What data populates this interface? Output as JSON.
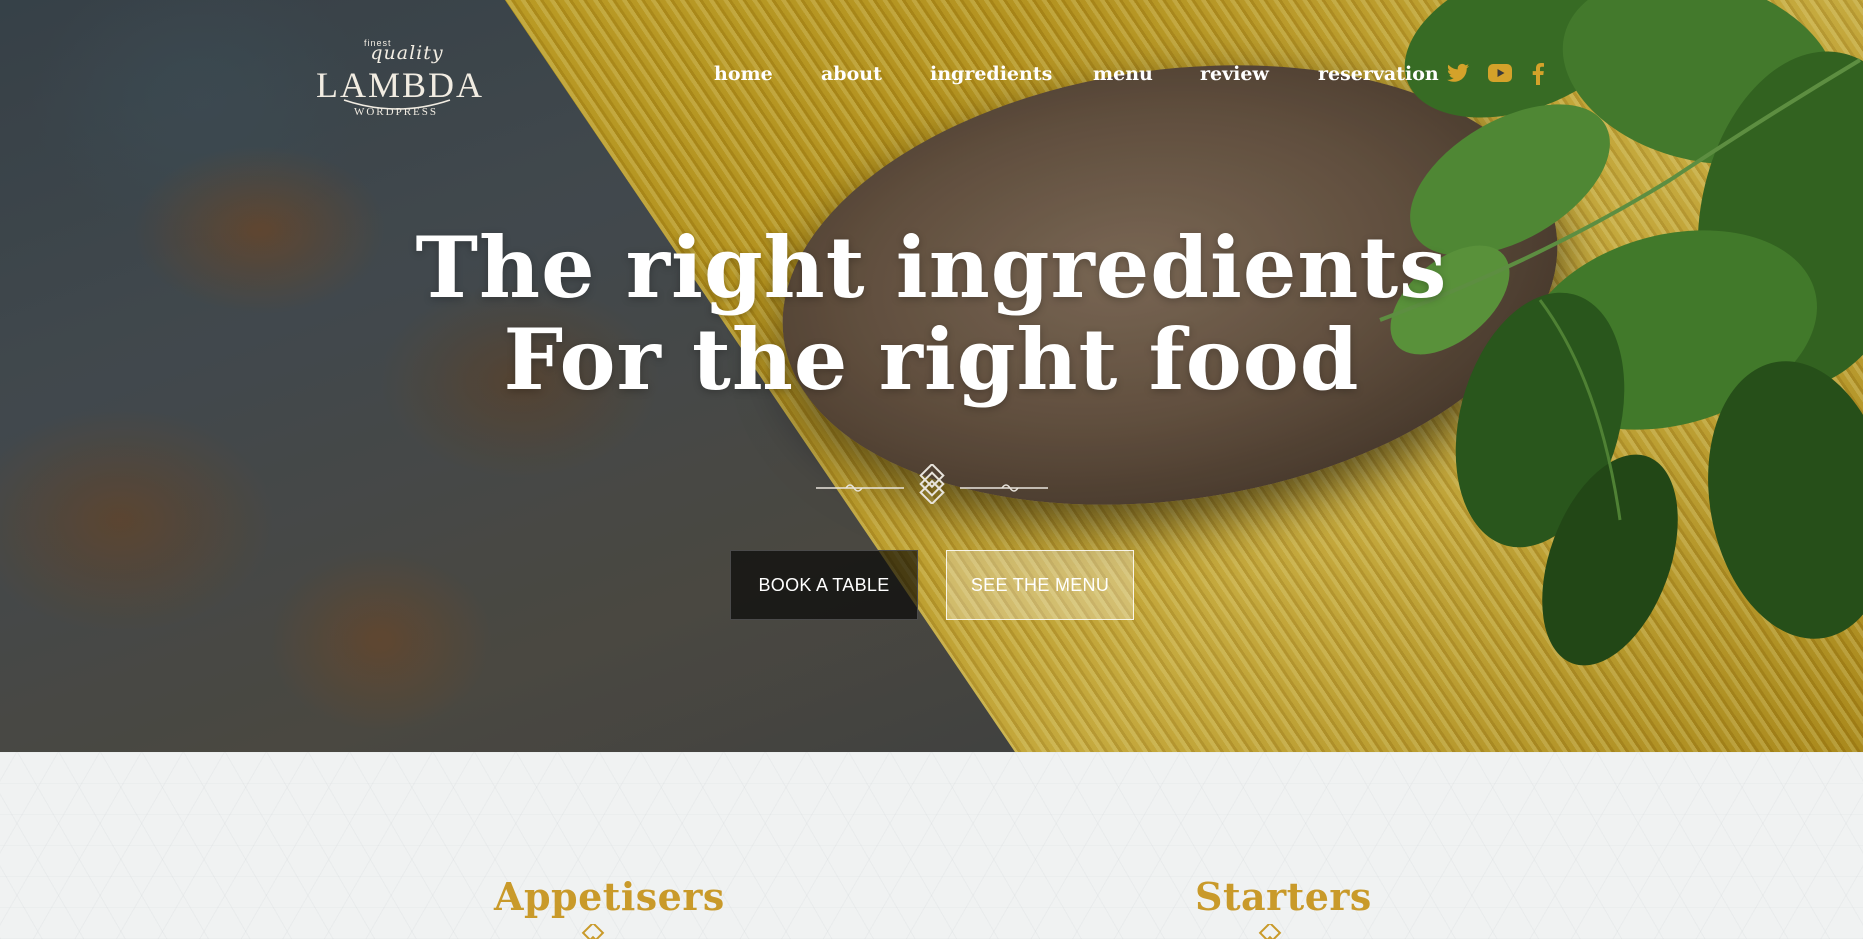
{
  "logo": {
    "finest": "finest",
    "quality": "quality",
    "name": "LAMBDA",
    "subtitle": "WORDPRESS"
  },
  "nav": {
    "items": [
      {
        "label": "home"
      },
      {
        "label": "about"
      },
      {
        "label": "ingredients"
      },
      {
        "label": "menu"
      },
      {
        "label": "review"
      },
      {
        "label": "reservation"
      }
    ]
  },
  "social": {
    "icons": [
      "twitter-icon",
      "youtube-icon",
      "facebook-icon"
    ],
    "color": "#d4a22a"
  },
  "hero": {
    "headline_line1": "The right ingredients",
    "headline_line2": "For the right food",
    "book_button": "BOOK A TABLE",
    "menu_button": "SEE THE MENU"
  },
  "sections": {
    "left_title": "Appetisers",
    "right_title": "Starters",
    "accent_color": "#c99a2a"
  }
}
